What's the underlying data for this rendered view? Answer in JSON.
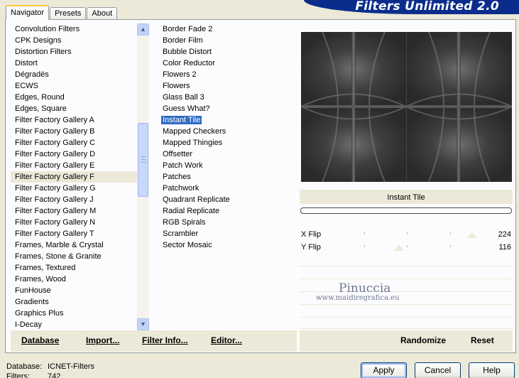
{
  "tabs": [
    "Navigator",
    "Presets",
    "About"
  ],
  "banner_title": "Filters Unlimited 2.0",
  "categories": [
    "Convolution Filters",
    "CPK Designs",
    "Distortion Filters",
    "Distort",
    "Dégradés",
    "ECWS",
    "Edges, Round",
    "Edges, Square",
    "Filter Factory Gallery A",
    "Filter Factory Gallery B",
    "Filter Factory Gallery C",
    "Filter Factory Gallery D",
    "Filter Factory Gallery E",
    "Filter Factory Gallery F",
    "Filter Factory Gallery G",
    "Filter Factory Gallery J",
    "Filter Factory Gallery M",
    "Filter Factory Gallery N",
    "Filter Factory Gallery T",
    "Frames, Marble & Crystal",
    "Frames, Stone & Granite",
    "Frames, Textured",
    "Frames, Wood",
    "FunHouse",
    "Gradients",
    "Graphics Plus",
    "I-Decay"
  ],
  "selected_category": "Filter Factory Gallery F",
  "filters": [
    "Border Fade 2",
    "Border Film",
    "Bubble Distort",
    "Color Reductor",
    "Flowers 2",
    "Flowers",
    "Glass Ball 3",
    "Guess What?",
    "Instant Tile",
    "Mapped Checkers",
    "Mapped Thingies",
    "Offsetter",
    "Patch Work",
    "Patches",
    "Patchwork",
    "Quadrant Replicate",
    "Radial Replicate",
    "RGB Spirals",
    "Scrambler",
    "Sector Mosaic"
  ],
  "selected_filter": "Instant Tile",
  "bottom_buttons": {
    "database": "Database",
    "import": "Import...",
    "filter_info": "Filter Info...",
    "editor": "Editor..."
  },
  "current_filter_name": "Instant Tile",
  "params": [
    {
      "label": "X Flip",
      "value": "224",
      "max": 255
    },
    {
      "label": "Y Flip",
      "value": "116",
      "max": 255
    }
  ],
  "right_buttons": {
    "randomize": "Randomize",
    "reset": "Reset"
  },
  "watermark": {
    "line1": "Pinuccia",
    "line2": "www.maidiregrafica.eu"
  },
  "status": {
    "database_label": "Database:",
    "database_value": "ICNET-Filters",
    "filters_label": "Filters:",
    "filters_value": "742"
  },
  "dialog_buttons": {
    "apply": "Apply",
    "cancel": "Cancel",
    "help": "Help"
  },
  "colors": {
    "selection": "#316ac5",
    "banner": "#0a2d8c",
    "face": "#ece9d8"
  }
}
